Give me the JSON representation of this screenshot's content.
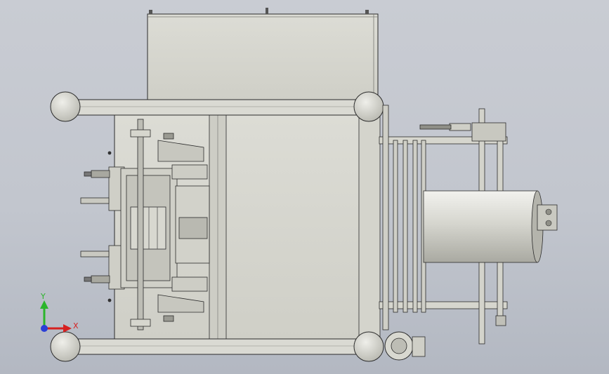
{
  "viewport": {
    "background_top": "#c9ccd3",
    "background_bottom": "#b3b8c2"
  },
  "colors": {
    "metal_light": "#d9d9d2",
    "metal_mid": "#c8c8bf",
    "metal_dark": "#9a9a92",
    "outline": "#2b2b2b",
    "axis_x": "#d62020",
    "axis_y": "#2bb52b",
    "axis_origin": "#2b3fd6"
  },
  "triad": {
    "x_label": "X",
    "y_label": "Y",
    "icon": "coordinate-triad-icon"
  }
}
